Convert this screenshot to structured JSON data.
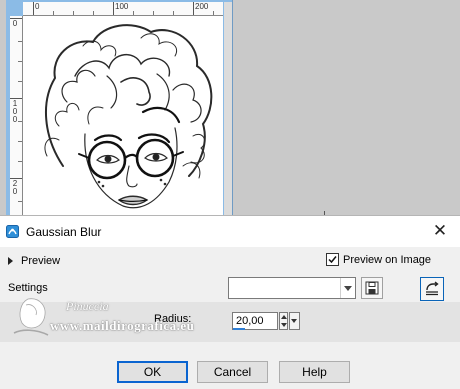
{
  "ruler": {
    "horizontal_labels": [
      "0",
      "100",
      "200"
    ],
    "vertical_labels": [
      "0",
      "1\n0\n0",
      "2\n0"
    ]
  },
  "dialog": {
    "title": "Gaussian Blur",
    "close_glyph": "✕",
    "preview_label": "Preview",
    "preview_on_image_label": "Preview on Image",
    "preview_on_image_checked": true,
    "settings_label": "Settings",
    "settings_value": "",
    "radius_label": "Radius:",
    "radius_value": "20,00",
    "ok_label": "OK",
    "cancel_label": "Cancel",
    "help_label": "Help"
  },
  "watermark": {
    "name": "Pinuccia",
    "url": "www.maildirografica.eu"
  },
  "icons": {
    "title": "gaussian-blur-icon",
    "close": "close-icon",
    "save": "save-preset-icon",
    "reset": "reset-to-default-icon"
  },
  "colors": {
    "canvas_window_frame": "#8bbbe6",
    "ok_border": "#0a64d0",
    "reset_border": "#0a64b8",
    "accent": "#2f7fd6"
  }
}
